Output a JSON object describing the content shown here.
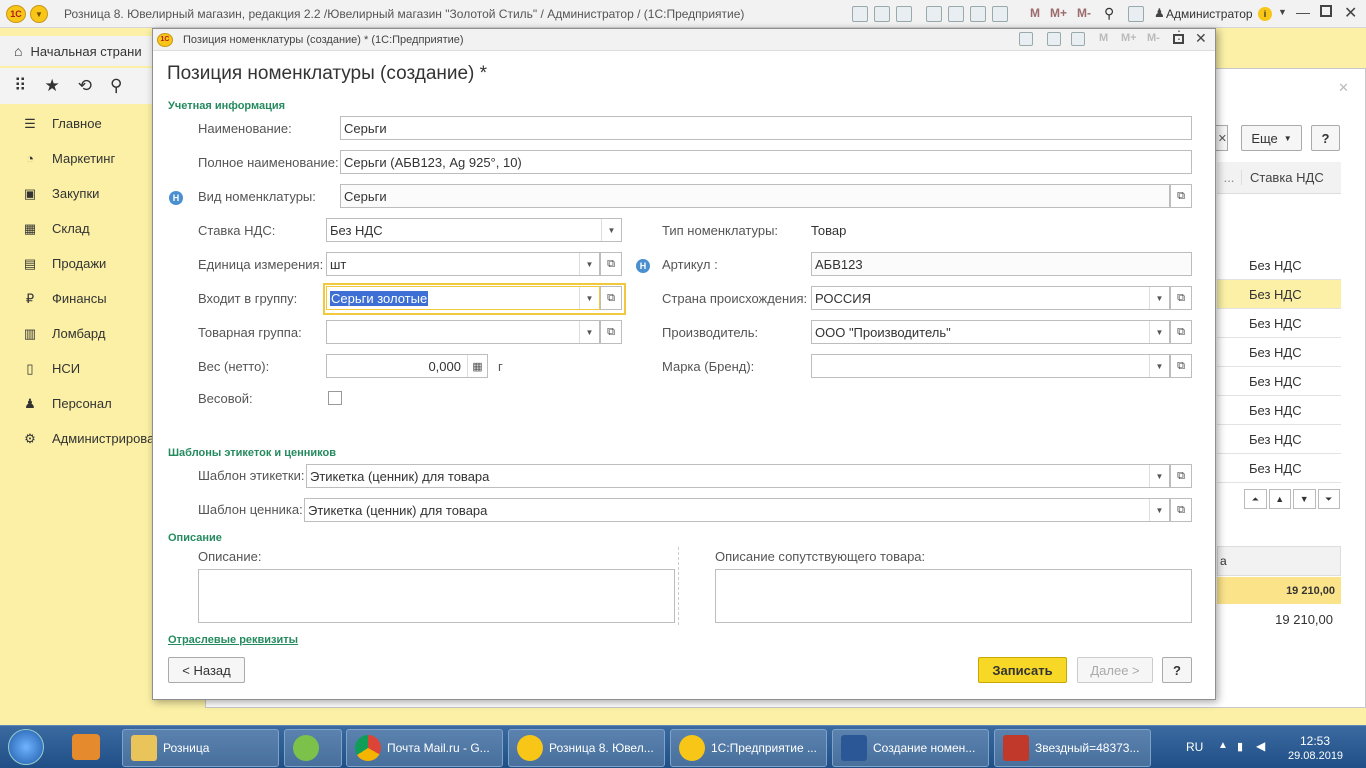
{
  "app": {
    "title": "Розница 8. Ювелирный магазин, редакция 2.2 /Ювелирный магазин \"Золотой Стиль\" / Администратор /  (1С:Предприятие)",
    "logo": "1С",
    "toolbar_m": [
      "M",
      "M+",
      "M-"
    ],
    "user": "Администратор",
    "home": "Начальная страни"
  },
  "sidebar": {
    "items": [
      {
        "label": "Главное",
        "icon": "menu-icon"
      },
      {
        "label": "Маркетинг",
        "icon": "marketing-icon"
      },
      {
        "label": "Закупки",
        "icon": "purchases-icon"
      },
      {
        "label": "Склад",
        "icon": "warehouse-icon"
      },
      {
        "label": "Продажи",
        "icon": "sales-icon"
      },
      {
        "label": "Финансы",
        "icon": "ruble-icon"
      },
      {
        "label": "Ломбард",
        "icon": "pawnshop-icon"
      },
      {
        "label": "НСИ",
        "icon": "reference-icon"
      },
      {
        "label": "Персонал",
        "icon": "person-icon"
      },
      {
        "label": "Администрирова",
        "icon": "gear-icon"
      }
    ]
  },
  "background": {
    "more_button": "Еще",
    "help_button": "?",
    "col_header": "Ставка НДС",
    "col_header_partial": "...",
    "vat_rows": [
      "Без НДС",
      "Без НДС",
      "Без НДС",
      "Без НДС",
      "Без НДС",
      "Без НДС",
      "Без НДС",
      "Без НДС"
    ],
    "total_label": "а",
    "total_1": "19 210,00",
    "total_2": "19 210,00"
  },
  "dialog": {
    "window_title": "Позиция номенклатуры (создание) *  (1С:Предприятие)",
    "heading": "Позиция номенклатуры (создание) *",
    "section_accounting": "Учетная информация",
    "name_label": "Наименование:",
    "name_value": "Серьги",
    "fullname_label": "Полное наименование:",
    "fullname_value": "Серьги (АБВ123, Ag 925°, 10)",
    "kind_label": "Вид номенклатуры:",
    "kind_value": "Серьги",
    "vat_label": "Ставка НДС:",
    "vat_value": "Без НДС",
    "type_label": "Тип номенклатуры:",
    "type_value": "Товар",
    "unit_label": "Единица измерения:",
    "unit_value": "шт",
    "article_label": "Артикул :",
    "article_value": "АБВ123",
    "group_label": "Входит в группу:",
    "group_value": "Серьги золотые",
    "country_label": "Страна происхождения:",
    "country_value": "РОССИЯ",
    "goods_group_label": "Товарная группа:",
    "goods_group_value": "",
    "maker_label": "Производитель:",
    "maker_value": "ООО \"Производитель\"",
    "weight_label": "Вес (нетто):",
    "weight_value": "0,000",
    "weight_unit": "г",
    "brand_label": "Марка (Бренд):",
    "brand_value": "",
    "weighted_label": "Весовой:",
    "section_templates": "Шаблоны этикеток  и  ценников",
    "label_tpl_label": "Шаблон этикетки:",
    "label_tpl_value": "Этикетка (ценник) для товара",
    "price_tpl_label": "Шаблон ценника:",
    "price_tpl_value": "Этикетка (ценник) для товара",
    "section_description": "Описание",
    "desc_label": "Описание:",
    "desc_related_label": "Описание сопутствующего товара:",
    "industry_link": "Отраслевые  реквизиты",
    "back_button": "< Назад",
    "save_button": "Записать",
    "next_button": "Далее >",
    "help_button": "?",
    "hint_badge": "H"
  },
  "taskbar": {
    "tasks": [
      "Розница",
      "",
      "Почта Mail.ru - G...",
      "Розница 8. Ювел...",
      "1С:Предприятие ...",
      "Создание номен...",
      "Звездный=48373..."
    ],
    "lang": "RU",
    "time": "12:53",
    "date": "29.08.2019"
  },
  "colors": {
    "accent_yellow": "#fbf0a6",
    "section_green": "#258b5f",
    "save_button": "#f7d826",
    "focus_border": "#f0c93c"
  }
}
